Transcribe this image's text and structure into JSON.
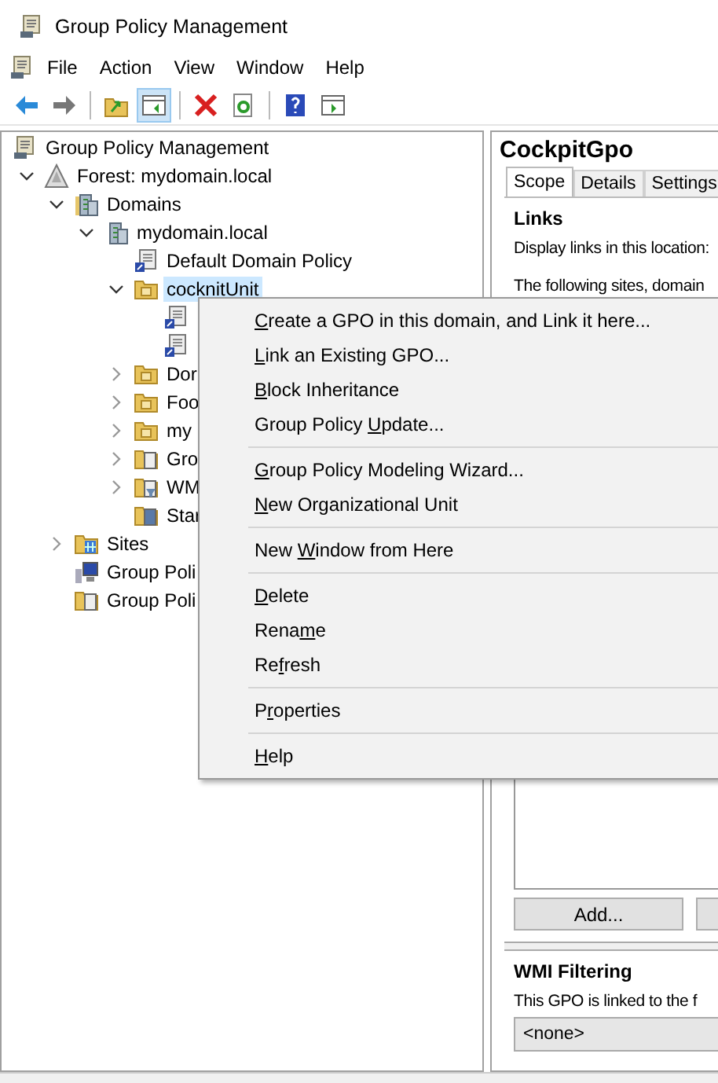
{
  "window": {
    "title": "Group Policy Management"
  },
  "menu_bar": [
    "File",
    "Action",
    "View",
    "Window",
    "Help"
  ],
  "toolbar": [
    {
      "kind": "back",
      "selected": false
    },
    {
      "kind": "forward",
      "selected": false
    },
    {
      "kind": "sep"
    },
    {
      "kind": "up",
      "selected": false
    },
    {
      "kind": "panel",
      "selected": true
    },
    {
      "kind": "sep"
    },
    {
      "kind": "delete",
      "selected": false
    },
    {
      "kind": "refresh",
      "selected": false
    },
    {
      "kind": "sep"
    },
    {
      "kind": "help",
      "selected": false
    },
    {
      "kind": "action-pane",
      "selected": false
    }
  ],
  "tree": {
    "label": "Group Policy Management",
    "kind": "console",
    "selected": false,
    "children": [
      {
        "label": "Forest: mydomain.local",
        "kind": "forest",
        "expanded": true,
        "selected": false,
        "children": [
          {
            "label": "Domains",
            "kind": "domains",
            "expanded": true,
            "selected": false,
            "children": [
              {
                "label": "mydomain.local",
                "kind": "domain",
                "expanded": true,
                "selected": false,
                "children": [
                  {
                    "label": "Default Domain Policy",
                    "kind": "gpo-link",
                    "selected": false
                  },
                  {
                    "label": "cocknitUnit",
                    "kind": "ou",
                    "expanded": true,
                    "selected": true,
                    "children": [
                      {
                        "kind": "gpo-link"
                      },
                      {
                        "kind": "gpo-link"
                      }
                    ]
                  },
                  {
                    "label": "Dor",
                    "kind": "ou",
                    "expanded": false,
                    "selected": false
                  },
                  {
                    "label": "Foo",
                    "kind": "ou",
                    "expanded": false,
                    "selected": false
                  },
                  {
                    "label": "my",
                    "kind": "ou",
                    "expanded": false,
                    "selected": false
                  },
                  {
                    "label": "Gro",
                    "kind": "gpo-folder",
                    "expanded": false,
                    "selected": false
                  },
                  {
                    "label": "WM",
                    "kind": "wmi",
                    "expanded": false,
                    "selected": false
                  },
                  {
                    "label": "Star",
                    "kind": "starter",
                    "selected": false
                  }
                ]
              }
            ]
          },
          {
            "label": "Sites",
            "kind": "sites",
            "expanded": false,
            "selected": false
          },
          {
            "label": "Group Poli",
            "kind": "modeling",
            "selected": false
          },
          {
            "label": "Group Poli",
            "kind": "results",
            "selected": false
          }
        ]
      }
    ]
  },
  "details": {
    "title": "CockpitGpo",
    "tabs": [
      {
        "label": "Scope",
        "selected": true
      },
      {
        "label": "Details",
        "selected": false
      },
      {
        "label": "Settings",
        "selected": false
      }
    ],
    "section": "Links",
    "display_label": "Display links in this location:",
    "list_caption": "The following sites, domain",
    "buttons": [
      "Add..."
    ],
    "wmi_heading": "WMI Filtering",
    "wmi_text": "This GPO is linked to the f",
    "wmi_value": "<none>"
  },
  "context_menu": [
    [
      {
        "key": "C",
        "post": "reate a GPO in this domain, and Link it here..."
      },
      {
        "key": "L",
        "post": "ink an Existing GPO..."
      },
      {
        "key": "B",
        "post": "lock Inheritance"
      },
      {
        "pre": "Group Policy ",
        "key": "U",
        "post": "pdate..."
      }
    ],
    [
      {
        "key": "G",
        "post": "roup Policy Modeling Wizard..."
      },
      {
        "key": "N",
        "post": "ew Organizational Unit"
      }
    ],
    [
      {
        "pre": "New ",
        "key": "W",
        "post": "indow from Here"
      }
    ],
    [
      {
        "key": "D",
        "post": "elete"
      },
      {
        "pre": "Rena",
        "key": "m",
        "post": "e"
      },
      {
        "pre": "Re",
        "key": "f",
        "post": "resh"
      }
    ],
    [
      {
        "pre": "P",
        "key": "r",
        "post": "operties"
      }
    ],
    [
      {
        "key": "H",
        "post": "elp"
      }
    ]
  ]
}
